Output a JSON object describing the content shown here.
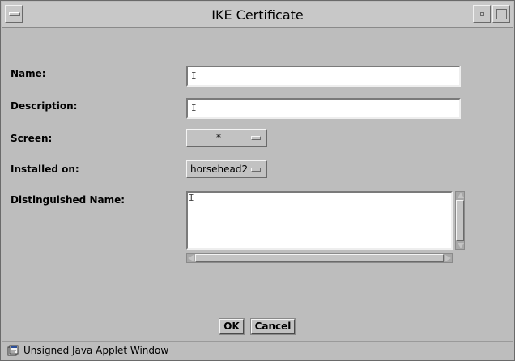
{
  "window": {
    "title": "IKE Certificate"
  },
  "form": {
    "name_label": "Name:",
    "description_label": "Description:",
    "screen_label": "Screen:",
    "screen_value": "*",
    "installed_on_label": "Installed on:",
    "installed_on_value": "horsehead2",
    "distinguished_name_label": "Distinguished Name:",
    "name_value": "",
    "description_value": "",
    "distinguished_name_value": ""
  },
  "buttons": {
    "ok": "OK",
    "cancel": "Cancel"
  },
  "status": {
    "text": "Unsigned Java Applet Window",
    "icon": "applet-warning-icon"
  },
  "colors": {
    "window_bg": "#bdbdbd",
    "field_bg": "#ffffff"
  }
}
